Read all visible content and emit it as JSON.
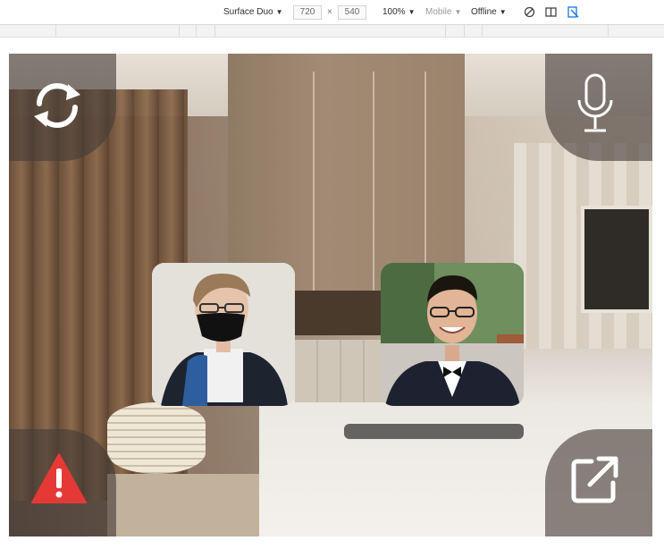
{
  "toolbar": {
    "device": "Surface Duo",
    "width": "720",
    "separator": "×",
    "height": "540",
    "zoom": "100%",
    "throttle": "Mobile",
    "network": "Offline"
  },
  "controls": {
    "switch_camera": "switch-camera-icon",
    "microphone": "microphone-icon",
    "alert": "alert-icon",
    "share": "open-external-icon"
  },
  "participants": [
    {
      "id": "participant-1",
      "description_icon": "video-tile"
    },
    {
      "id": "participant-2",
      "description_icon": "video-tile"
    }
  ],
  "colors": {
    "alert_red": "#e53935",
    "overlay": "#463c37",
    "icon_white": "#ffffff"
  }
}
